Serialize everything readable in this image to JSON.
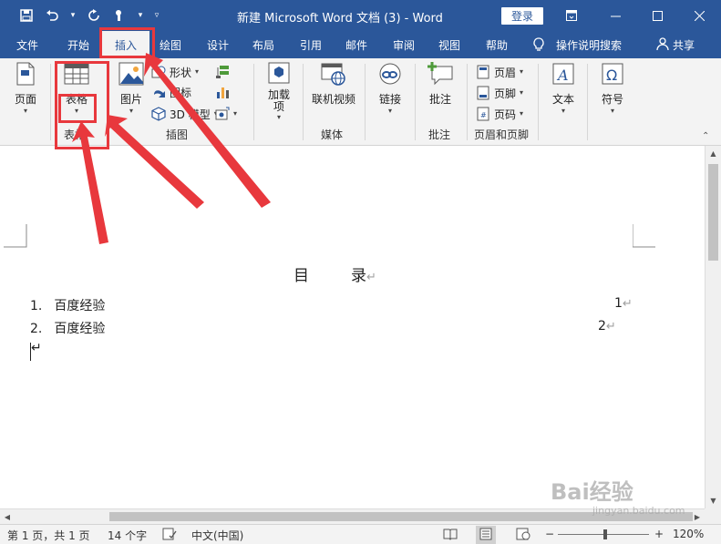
{
  "window": {
    "title": "新建 Microsoft Word 文档 (3)  -  Word",
    "login_label": "登录",
    "controls": [
      "ribbon-display-icon",
      "minimize-icon",
      "maximize-icon",
      "close-icon"
    ]
  },
  "quick_access": [
    "save-icon",
    "undo-icon",
    "redo-icon",
    "touch-mode-icon",
    "customize-icon"
  ],
  "tabs": [
    {
      "label": "文件",
      "active": false
    },
    {
      "label": "开始",
      "active": false
    },
    {
      "label": "插入",
      "active": true
    },
    {
      "label": "绘图",
      "active": false
    },
    {
      "label": "设计",
      "active": false
    },
    {
      "label": "布局",
      "active": false
    },
    {
      "label": "引用",
      "active": false
    },
    {
      "label": "邮件",
      "active": false
    },
    {
      "label": "审阅",
      "active": false
    },
    {
      "label": "视图",
      "active": false
    },
    {
      "label": "帮助",
      "active": false
    }
  ],
  "tell_me": "操作说明搜索",
  "share": "共享",
  "ribbon": {
    "pages": {
      "label": "页面"
    },
    "table": {
      "label": "表格",
      "group": "表格"
    },
    "illustrations": {
      "picture": "图片",
      "shapes": "形状",
      "icons": "图标",
      "model3d": "3D 模型",
      "group": "插图"
    },
    "addins": {
      "label": "加载\n项"
    },
    "media": {
      "online_video": "联机视频",
      "group": "媒体"
    },
    "links": {
      "label": "链接"
    },
    "comments": {
      "label": "批注",
      "group": "批注"
    },
    "header_footer": {
      "header": "页眉",
      "footer": "页脚",
      "page_number": "页码",
      "group": "页眉和页脚"
    },
    "text": {
      "label": "文本"
    },
    "symbols": {
      "label": "符号"
    }
  },
  "document": {
    "heading_left": "目",
    "heading_right": "录",
    "return_mark": "↵",
    "toc": [
      {
        "num": "1.",
        "text": "百度经验",
        "page": "1"
      },
      {
        "num": "2.",
        "text": "百度经验",
        "page": "2"
      }
    ]
  },
  "status": {
    "pages": "第 1 页，共 1 页",
    "words": "14 个字",
    "language": "中文(中国)",
    "zoom": "120%"
  },
  "watermark": {
    "brand": "Bai经验",
    "url": "jingyan.baidu.com"
  },
  "colors": {
    "accent": "#2b579a",
    "highlight": "#e8383d"
  }
}
